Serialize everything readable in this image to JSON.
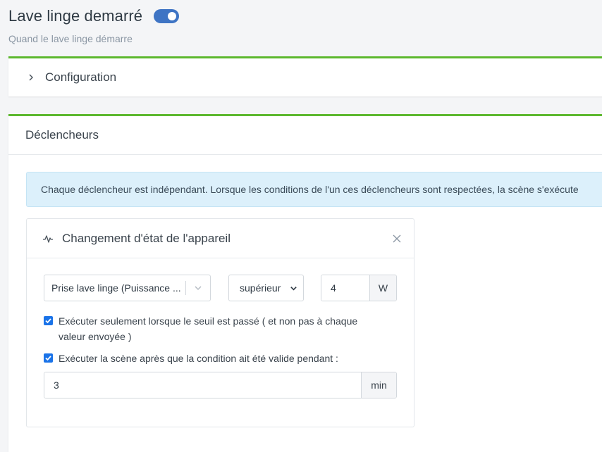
{
  "header": {
    "title": "Lave linge demarré",
    "subtitle": "Quand le lave linge démarre",
    "enabled": true
  },
  "config": {
    "label": "Configuration"
  },
  "triggers": {
    "title": "Déclencheurs",
    "info": "Chaque déclencheur est indépendant. Lorsque les conditions de l'un ces déclencheurs sont respectées, la scène s'exécute"
  },
  "card": {
    "title": "Changement d'état de l'appareil",
    "device_value": "Prise lave linge (Puissance ...",
    "operator_value": "supérieur",
    "threshold_value": "4",
    "threshold_unit": "W",
    "check1_label": "Exécuter seulement lorsque le seuil est passé ( et non pas à chaque valeur envoyée )",
    "check1_checked": true,
    "check2_label": "Exécuter la scène après que la condition ait été valide pendant :",
    "check2_checked": true,
    "duration_value": "3",
    "duration_unit": "min"
  },
  "colors": {
    "accent_green": "#5cb82e",
    "toggle_blue": "#3e74c4",
    "checkbox_blue": "#1a73e8",
    "info_bg": "#dcf0fb"
  }
}
